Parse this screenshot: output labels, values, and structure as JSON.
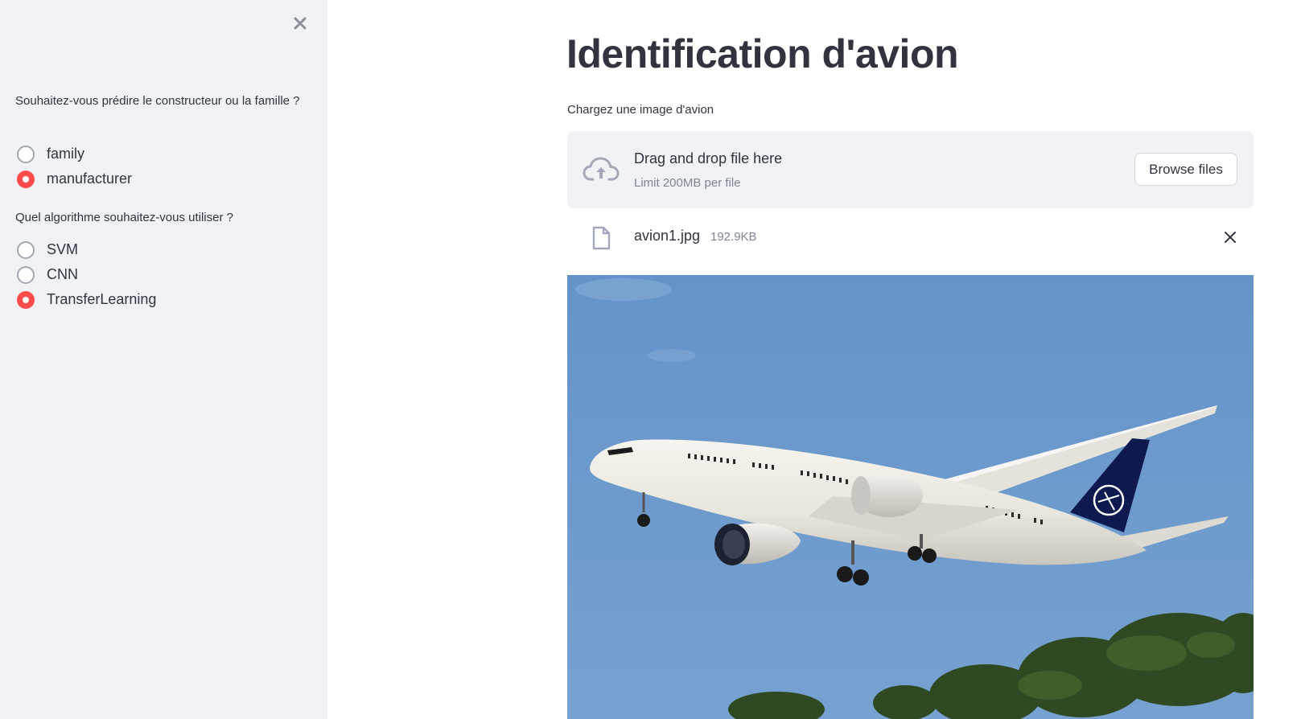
{
  "sidebar": {
    "close_icon": "close-icon",
    "question1": "Souhaitez-vous prédire le constructeur ou la famille ?",
    "options1": [
      {
        "label": "family",
        "selected": false
      },
      {
        "label": "manufacturer",
        "selected": true
      }
    ],
    "question2": "Quel algorithme souhaitez-vous utiliser ?",
    "options2": [
      {
        "label": "SVM",
        "selected": false
      },
      {
        "label": "CNN",
        "selected": false
      },
      {
        "label": "TransferLearning",
        "selected": true
      }
    ]
  },
  "main": {
    "title": "Identification d'avion",
    "upload_label": "Chargez une image d'avion",
    "dropzone": {
      "title": "Drag and drop file here",
      "limit": "Limit 200MB per file",
      "browse_label": "Browse files",
      "icon": "cloud-upload-icon"
    },
    "file": {
      "name": "avion1.jpg",
      "size": "192.9KB",
      "icon": "file-icon",
      "remove_icon": "close-icon"
    },
    "image": {
      "subject": "airplane photo"
    }
  },
  "colors": {
    "sidebar_bg": "#f0f2f6",
    "accent": "#ff4b4b",
    "text": "#31333f",
    "muted": "#808495",
    "sky": "#6f9acb"
  }
}
